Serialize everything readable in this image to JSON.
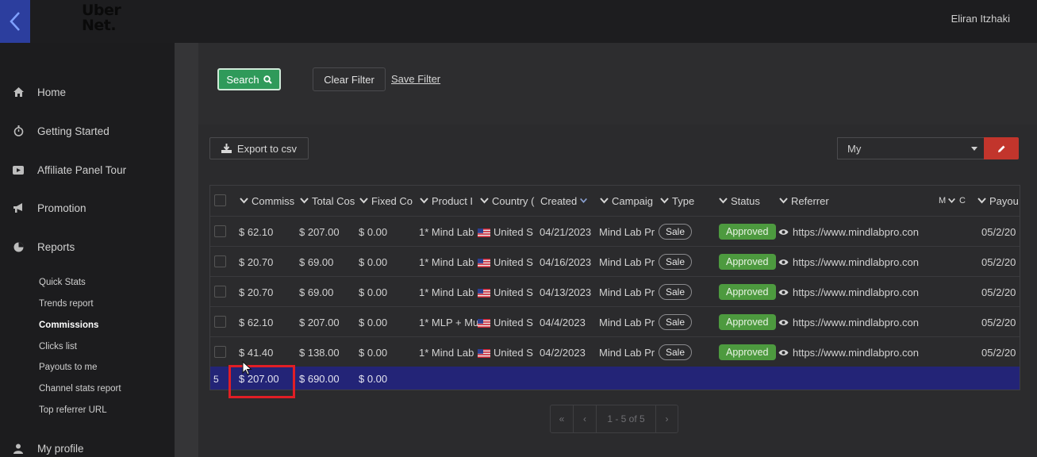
{
  "app": {
    "logo_line1": "Uber",
    "logo_line2": "Net.",
    "user_name": "Eliran Itzhaki"
  },
  "sidebar": {
    "items": [
      {
        "label": "Home",
        "icon": "home-icon"
      },
      {
        "label": "Getting Started",
        "icon": "stopwatch-icon"
      },
      {
        "label": "Affiliate Panel Tour",
        "icon": "video-icon"
      },
      {
        "label": "Promotion",
        "icon": "bullhorn-icon"
      },
      {
        "label": "Reports",
        "icon": "pie-chart-icon"
      },
      {
        "label": "My profile",
        "icon": "user-icon"
      }
    ],
    "report_items": [
      {
        "label": "Quick Stats"
      },
      {
        "label": "Trends report"
      },
      {
        "label": "Commissions",
        "active": true
      },
      {
        "label": "Clicks list"
      },
      {
        "label": "Payouts to me"
      },
      {
        "label": "Channel stats report"
      },
      {
        "label": "Top referrer URL"
      }
    ]
  },
  "filters": {
    "search_label": "Search",
    "clear_label": "Clear Filter",
    "save_label": "Save Filter"
  },
  "toolbar": {
    "export_label": "Export to csv",
    "view_selected": "My"
  },
  "table": {
    "columns": [
      "Commiss",
      "Total Cos",
      "Fixed Co",
      "Product I",
      "Country (",
      "Created",
      "Campaig",
      "Type",
      "Status",
      "Referrer",
      "M",
      "C",
      "Payou"
    ],
    "rows": [
      {
        "commission": "$ 62.10",
        "total_cost": "$ 207.00",
        "fixed_cost": "$ 0.00",
        "product": "1* Mind Lab",
        "country": "United S",
        "created": "04/21/2023",
        "campaign": "Mind Lab Pr",
        "type": "Sale",
        "status": "Approved",
        "referrer": "https://www.mindlabpro.con",
        "payout": "05/2/20"
      },
      {
        "commission": "$ 20.70",
        "total_cost": "$ 69.00",
        "fixed_cost": "$ 0.00",
        "product": "1* Mind Lab",
        "country": "United S",
        "created": "04/16/2023",
        "campaign": "Mind Lab Pr",
        "type": "Sale",
        "status": "Approved",
        "referrer": "https://www.mindlabpro.con",
        "payout": "05/2/20"
      },
      {
        "commission": "$ 20.70",
        "total_cost": "$ 69.00",
        "fixed_cost": "$ 0.00",
        "product": "1* Mind Lab",
        "country": "United S",
        "created": "04/13/2023",
        "campaign": "Mind Lab Pr",
        "type": "Sale",
        "status": "Approved",
        "referrer": "https://www.mindlabpro.con",
        "payout": "05/2/20"
      },
      {
        "commission": "$ 62.10",
        "total_cost": "$ 207.00",
        "fixed_cost": "$ 0.00",
        "product": "1* MLP + Mu",
        "country": "United S",
        "created": "04/4/2023",
        "campaign": "Mind Lab Pr",
        "type": "Sale",
        "status": "Approved",
        "referrer": "https://www.mindlabpro.con",
        "payout": "05/2/20"
      },
      {
        "commission": "$ 41.40",
        "total_cost": "$ 138.00",
        "fixed_cost": "$ 0.00",
        "product": "1* Mind Lab",
        "country": "United S",
        "created": "04/2/2023",
        "campaign": "Mind Lab Pr",
        "type": "Sale",
        "status": "Approved",
        "referrer": "https://www.mindlabpro.con",
        "payout": "05/2/20"
      }
    ],
    "totals": {
      "count": "5",
      "commission": "$ 207.00",
      "total_cost": "$ 690.00",
      "fixed_cost": "$ 0.00"
    }
  },
  "pagination": {
    "first": "«",
    "prev": "‹",
    "info": "1 - 5 of 5",
    "next": "›"
  },
  "colors": {
    "accent_green": "#2f9a5a",
    "approved_green": "#4d9a3f",
    "totals_row": "#232477",
    "edit_red": "#c2352c",
    "highlight_red": "#e01e25"
  }
}
